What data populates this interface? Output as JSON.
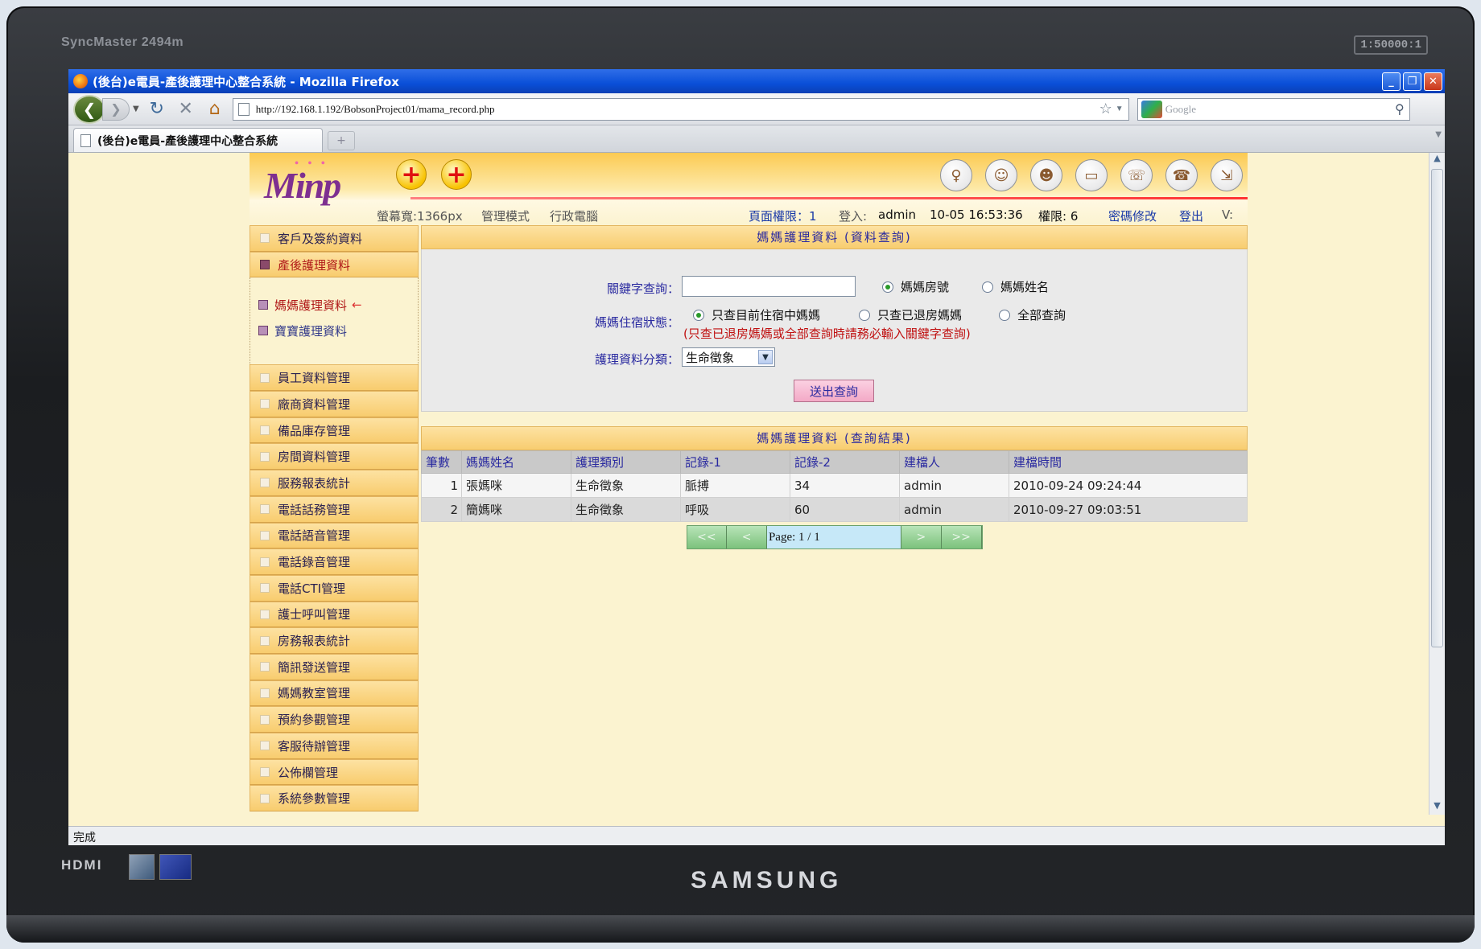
{
  "monitor": {
    "model": "SyncMaster 2494m",
    "badge": "1:50000:1",
    "hdmi": "HDMI",
    "brand": "SAMSUNG"
  },
  "browser": {
    "window_title": "(後台)e電員-產後護理中心整合系統 - Mozilla Firefox",
    "url": "http://192.168.1.192/BobsonProject01/mama_record.php",
    "search_placeholder": "Google",
    "tab_title": "(後台)e電員-產後護理中心整合系統",
    "new_tab": "+",
    "status": "完成"
  },
  "app": {
    "logo": "Minp",
    "header": {
      "screen_width_label": "螢幕寬:1366px",
      "mode": "管理模式",
      "computer": "行政電腦",
      "page_permission": "頁面權限：1",
      "login_label": "登入:",
      "login_user": "admin",
      "datetime": "10-05 16:53:36",
      "permission": "權限: 6",
      "change_password": "密碼修改",
      "logout": "登出",
      "version": "V:"
    },
    "sidebar": {
      "top_items": [
        "客戶及簽約資料",
        "產後護理資料"
      ],
      "sub_items": [
        "媽媽護理資料",
        "寶寶護理資料"
      ],
      "current_arrow": "←",
      "items": [
        "員工資料管理",
        "廠商資料管理",
        "備品庫存管理",
        "房間資料管理",
        "服務報表統計",
        "電話話務管理",
        "電話語音管理",
        "電話錄音管理",
        "電話CTI管理",
        "護士呼叫管理",
        "房務報表統計",
        "簡訊發送管理",
        "媽媽教室管理",
        "預約參觀管理",
        "客服待辦管理",
        "公佈欄管理",
        "系統參數管理"
      ]
    },
    "query": {
      "title": "媽媽護理資料 (資料查詢)",
      "keyword_label": "關鍵字查詢：",
      "keyword_value": "",
      "keyword_options": [
        "媽媽房號",
        "媽媽姓名"
      ],
      "status_label": "媽媽住宿狀態：",
      "status_options": [
        "只查目前住宿中媽媽",
        "只查已退房媽媽",
        "全部查詢"
      ],
      "status_note": "(只查已退房媽媽或全部查詢時請務必輸入關鍵字查詢)",
      "category_label": "護理資料分類：",
      "category_value": "生命徵象",
      "submit": "送出查詢"
    },
    "results": {
      "title": "媽媽護理資料 (查詢結果)",
      "columns": [
        "筆數",
        "媽媽姓名",
        "護理類別",
        "記錄-1",
        "記錄-2",
        "建檔人",
        "建檔時間"
      ],
      "rows": [
        [
          "1",
          "張媽咪",
          "生命徵象",
          "脈搏",
          "34",
          "admin",
          "2010-09-24 09:24:44"
        ],
        [
          "2",
          "簡媽咪",
          "生命徵象",
          "呼吸",
          "60",
          "admin",
          "2010-09-27 09:03:51"
        ]
      ],
      "pager": {
        "first": "<<",
        "prev": "<",
        "text": "Page: 1 / 1",
        "next": ">",
        "last": ">>"
      }
    }
  }
}
